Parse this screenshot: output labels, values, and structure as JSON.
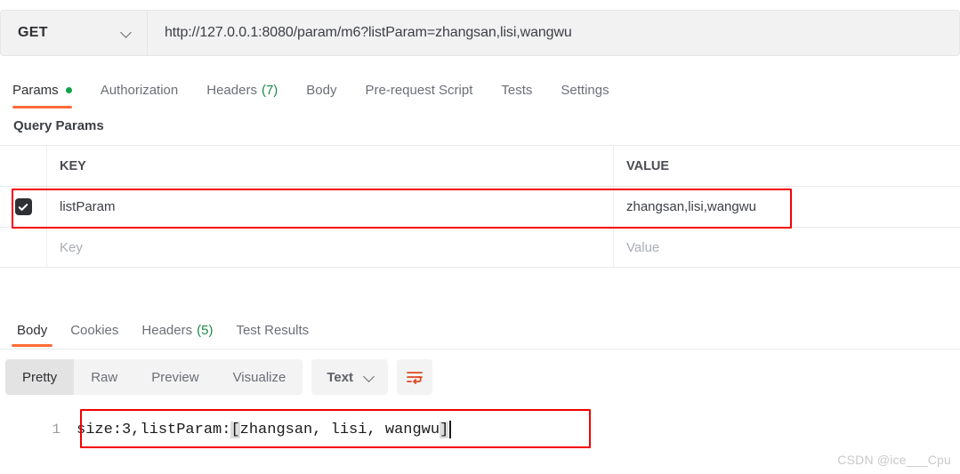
{
  "request": {
    "method": "GET",
    "url": "http://127.0.0.1:8080/param/m6?listParam=zhangsan,lisi,wangwu",
    "tabs": [
      {
        "label": "Params",
        "active": true,
        "dot": true
      },
      {
        "label": "Authorization",
        "active": false
      },
      {
        "label": "Headers",
        "count": "(7)",
        "active": false
      },
      {
        "label": "Body",
        "active": false
      },
      {
        "label": "Pre-request Script",
        "active": false
      },
      {
        "label": "Tests",
        "active": false
      },
      {
        "label": "Settings",
        "active": false
      }
    ]
  },
  "query_params": {
    "title": "Query Params",
    "columns": {
      "key": "KEY",
      "value": "VALUE"
    },
    "rows": [
      {
        "checked": true,
        "key": "listParam",
        "value": "zhangsan,lisi,wangwu"
      }
    ],
    "empty_row": {
      "key_placeholder": "Key",
      "value_placeholder": "Value"
    }
  },
  "response": {
    "tabs": [
      {
        "label": "Body",
        "active": true
      },
      {
        "label": "Cookies",
        "active": false
      },
      {
        "label": "Headers",
        "count": "(5)",
        "active": false
      },
      {
        "label": "Test Results",
        "active": false
      }
    ],
    "format_tabs": [
      {
        "label": "Pretty",
        "active": true
      },
      {
        "label": "Raw",
        "active": false
      },
      {
        "label": "Preview",
        "active": false
      },
      {
        "label": "Visualize",
        "active": false
      }
    ],
    "content_type": "Text",
    "body": {
      "line_number": "1",
      "prefix": "size:3,listParam:",
      "open_bracket": "[",
      "items": "zhangsan, lisi, wangwu",
      "close_bracket": "]",
      "full_text": "size:3,listParam:[zhangsan, lisi, wangwu]"
    }
  },
  "watermark": "CSDN @ice___Cpu",
  "colors": {
    "accent_orange": "#ff6c37",
    "highlight_red": "#f40000",
    "green_dot": "#12a147",
    "count_green": "#1c8c4a"
  }
}
